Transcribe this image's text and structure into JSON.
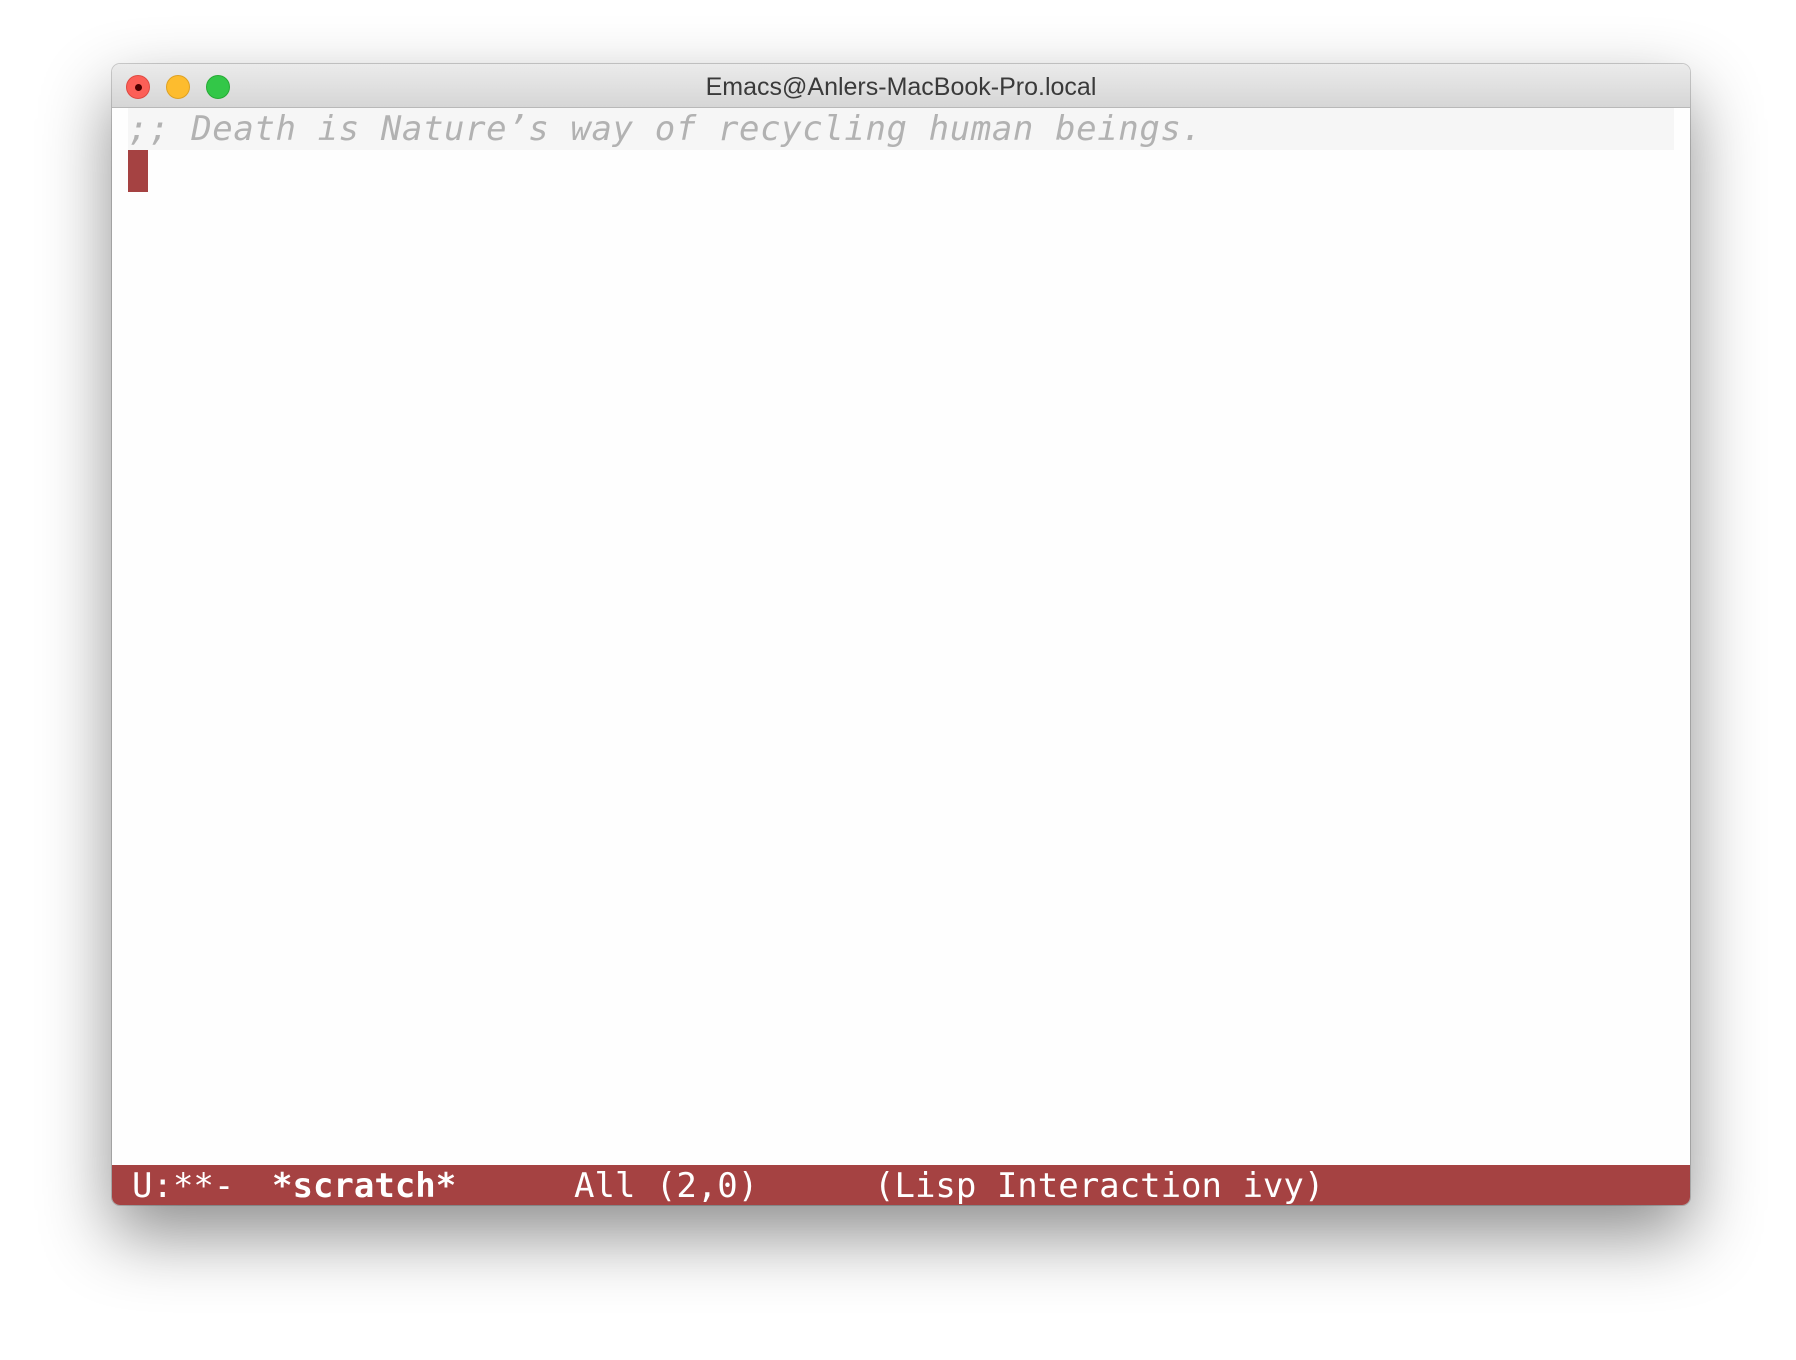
{
  "window": {
    "title": "Emacs@Anlers-MacBook-Pro.local"
  },
  "buffer": {
    "lines": [
      ";; Death is Nature’s way of recycling human beings."
    ]
  },
  "modeline": {
    "status": "U:**-",
    "buffer_name": "*scratch*",
    "position": "All (2,0)",
    "mode": "(Lisp Interaction ivy)"
  },
  "colors": {
    "modeline_bg": "#a54242",
    "cursor": "#a54242",
    "comment": "#b2b2b2",
    "current_line_bg": "#f6f6f6",
    "close_button": "#fc5f57",
    "minimize_button": "#fdbc2e",
    "zoom_button": "#33c748"
  }
}
